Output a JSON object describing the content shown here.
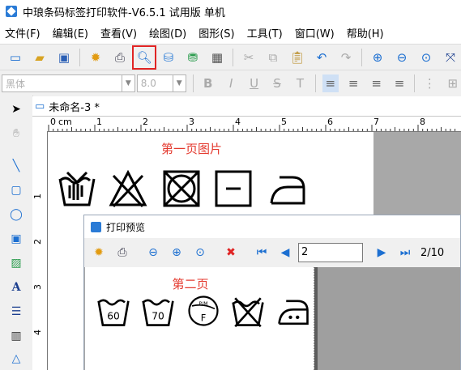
{
  "window": {
    "title": "中琅条码标签打印软件-V6.5.1 试用版 单机"
  },
  "menu": [
    "文件(F)",
    "编辑(E)",
    "查看(V)",
    "绘图(D)",
    "图形(S)",
    "工具(T)",
    "窗口(W)",
    "帮助(H)"
  ],
  "format_bar": {
    "font_name": "黑体",
    "font_size": "8.0"
  },
  "document": {
    "tab_label": "未命名-3 *",
    "ruler_unit": "cm",
    "page_heading": "第一页图片"
  },
  "ruler_h_labels": [
    "0",
    "1",
    "2",
    "3",
    "4",
    "5",
    "6",
    "7",
    "8"
  ],
  "ruler_v_labels": [
    "1",
    "2",
    "3",
    "4"
  ],
  "print_preview": {
    "title": "打印预览",
    "page_value": "2",
    "page_count": "2/10",
    "page_heading": "第二页"
  },
  "symbols_page2_text": {
    "wash60": "60",
    "wash70": "70",
    "dryclean_top": "P/M",
    "dryclean_letter": "F"
  },
  "colors": {
    "heading_red": "#e43a2f",
    "toolbar_bg": "#f0f0f0",
    "canvas_gray": "#a8a8a8",
    "highlight": "#e02424"
  }
}
